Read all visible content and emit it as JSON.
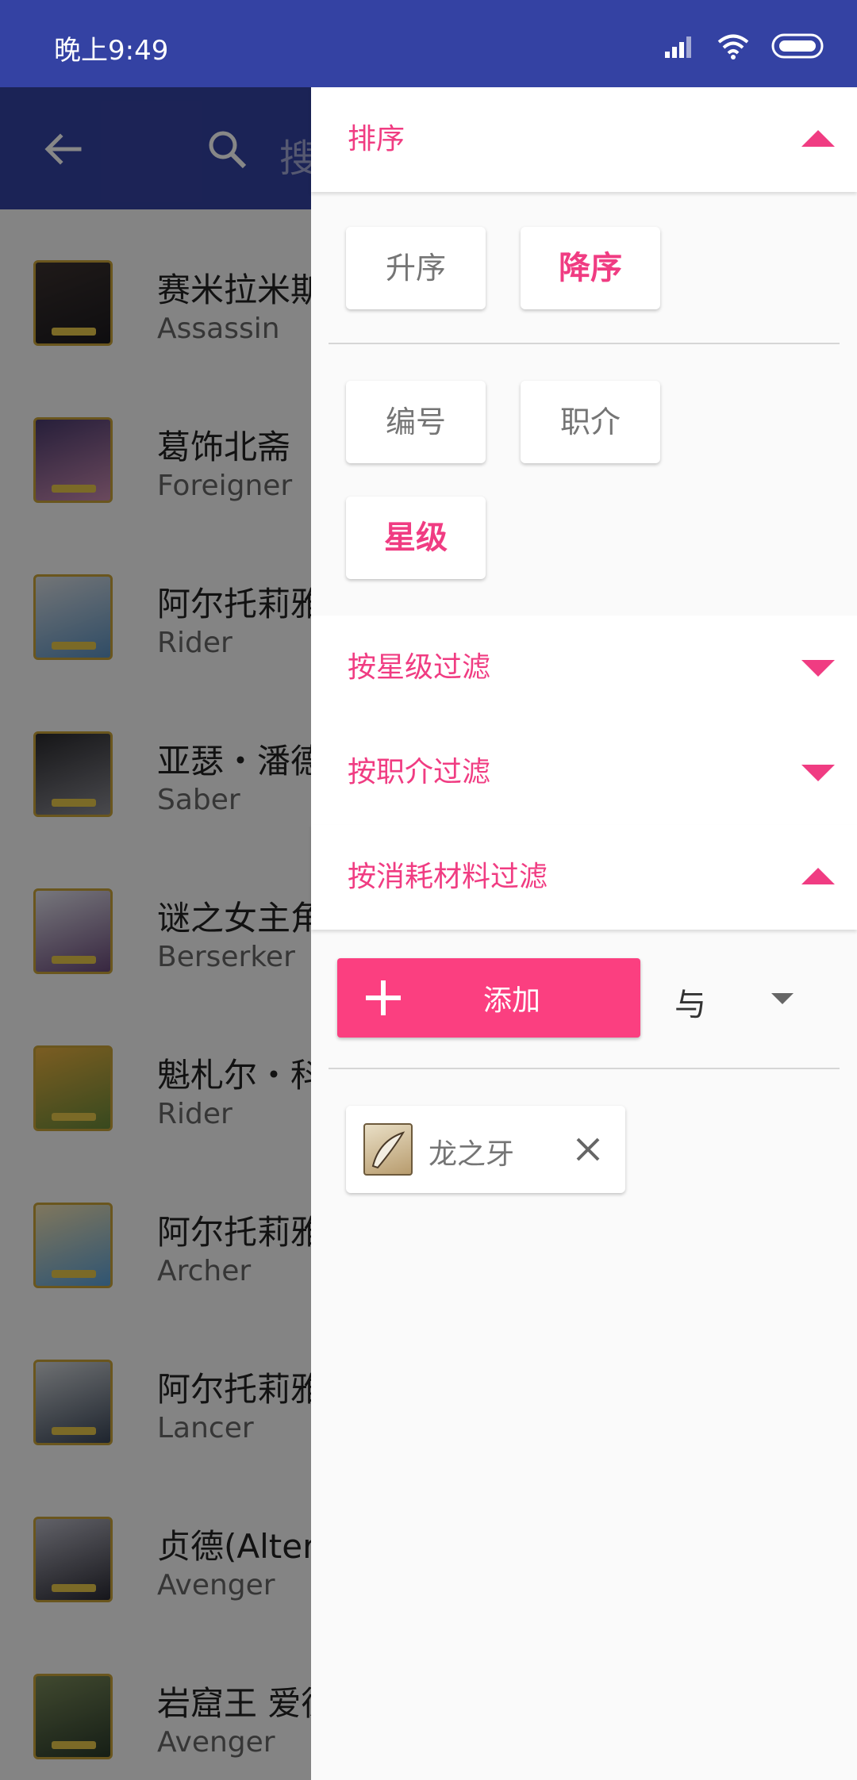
{
  "status_bar": {
    "time": "晚上9:49",
    "icons": [
      "signal-icon",
      "wifi-icon",
      "battery-icon"
    ]
  },
  "app_bar": {
    "search_hint": "搜",
    "icons": [
      "back-arrow-icon",
      "search-icon"
    ]
  },
  "servant_list": [
    {
      "name": "赛米拉米斯",
      "class": "Assassin"
    },
    {
      "name": "葛饰北斋",
      "class": "Foreigner"
    },
    {
      "name": "阿尔托莉雅",
      "class": "Rider"
    },
    {
      "name": "亚瑟・潘德",
      "class": "Saber"
    },
    {
      "name": "谜之女主角",
      "class": "Berserker"
    },
    {
      "name": "魁札尔・科",
      "class": "Rider"
    },
    {
      "name": "阿尔托莉雅",
      "class": "Archer"
    },
    {
      "name": "阿尔托莉雅",
      "class": "Lancer"
    },
    {
      "name": "贞德(Alter",
      "class": "Avenger"
    },
    {
      "name": "岩窟王 爱德",
      "class": "Avenger"
    }
  ],
  "drawer": {
    "sort": {
      "title": "排序",
      "expanded": true,
      "order": {
        "options": [
          {
            "label": "升序",
            "selected": false
          },
          {
            "label": "降序",
            "selected": true
          }
        ]
      },
      "keys": {
        "options": [
          {
            "label": "编号",
            "selected": false
          },
          {
            "label": "职介",
            "selected": false
          },
          {
            "label": "星级",
            "selected": true
          }
        ]
      }
    },
    "filter_by_rarity": {
      "title": "按星级过滤",
      "expanded": false
    },
    "filter_by_class": {
      "title": "按职介过滤",
      "expanded": false
    },
    "filter_by_material": {
      "title": "按消耗材料过滤",
      "expanded": true,
      "add_label": "添加",
      "logic_value": "与",
      "materials": [
        {
          "name": "龙之牙",
          "icon": "dragon-fang-material-icon"
        }
      ]
    }
  },
  "colors": {
    "primary": "#3442a3",
    "accent": "#f03c82",
    "button": "#fb3f80",
    "scrim": "rgba(0,0,0,0.47)"
  }
}
